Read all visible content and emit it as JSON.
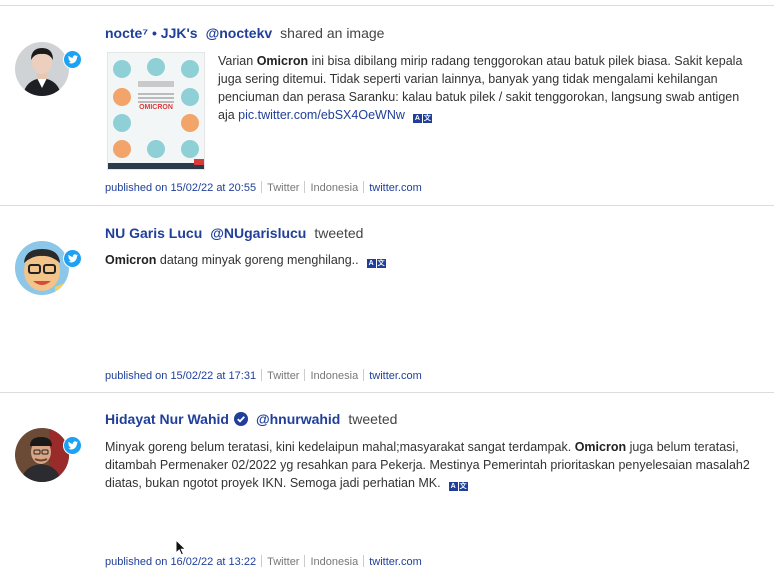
{
  "posts": [
    {
      "author": "nocte⁷ • JJK's",
      "handle": "@noctekv",
      "action": "shared an image",
      "text_before": "Varian ",
      "keyword": "Omicron",
      "text_after": " ini bisa dibilang mirip radang tenggorokan atau batuk pilek biasa. Sakit kepala juga sering ditemui. Tidak seperti varian lainnya, banyak yang tidak mengalami kehilangan penciuman dan perasa Saranku: kalau batuk pilek / sakit tenggorokan, langsung swab antigen aja ",
      "link": "pic.twitter.com/ebSX4OeWNw",
      "published": "published on 15/02/22 at 20:55",
      "source": "Twitter",
      "country": "Indonesia",
      "domain": "twitter.com",
      "image_title": "OMICRON"
    },
    {
      "author": "NU Garis Lucu",
      "handle": "@NUgarislucu",
      "action": "tweeted",
      "keyword": "Omicron",
      "text_after": " datang minyak goreng menghilang..",
      "published": "published on 15/02/22 at 17:31",
      "source": "Twitter",
      "country": "Indonesia",
      "domain": "twitter.com"
    },
    {
      "author": "Hidayat Nur Wahid",
      "handle": "@hnurwahid",
      "action": "tweeted",
      "text_before": "Minyak goreng belum teratasi, kini kedelaipun mahal;masyarakat sangat terdampak. ",
      "keyword": "Omicron",
      "text_after": " juga belum teratasi, ditambah Permenaker 02/2022 yg resahkan para Pekerja. Mestinya Pemerintah prioritaskan penyelesaian masalah2 diatas, bukan ngotot proyek IKN. Semoga jadi perhatian MK.",
      "published": "published on 16/02/22 at 13:22",
      "source": "Twitter",
      "country": "Indonesia",
      "domain": "twitter.com"
    }
  ],
  "icons": {
    "twitter_badge": "twitter-icon",
    "verified": "verified-icon",
    "translate": "translate-icon"
  },
  "colors": {
    "accent": "#1f3f9a",
    "twitter": "#1da1f2",
    "omicron_red": "#d93a3a"
  }
}
